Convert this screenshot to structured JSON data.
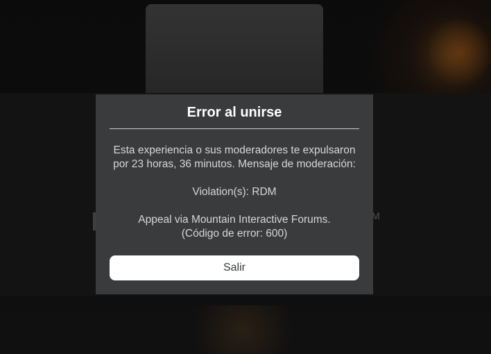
{
  "dialog": {
    "title": "Error al unirse",
    "message_line1": "Esta experiencia o sus moderadores te expulsaron",
    "message_line2": "por 23 horas, 36 minutos. Mensaje de moderación:",
    "violation": "Violation(s): RDM",
    "appeal": "Appeal via Mountain Interactive Forums.",
    "error_code": "(Código de error: 600)",
    "exit_label": "Salir"
  },
  "background": {
    "partial_text_right": "M"
  },
  "colors": {
    "dialog_bg": "#393b3d",
    "button_bg": "#ffffff",
    "title_text": "#ffffff",
    "body_text": "#d7d7d7"
  }
}
